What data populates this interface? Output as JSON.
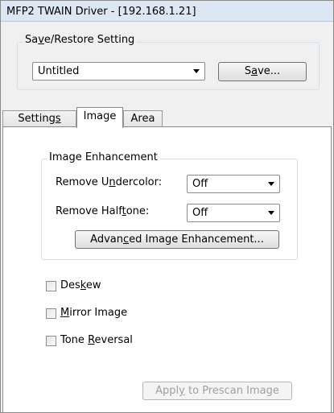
{
  "window": {
    "title": "MFP2 TWAIN Driver - [192.168.1.21]"
  },
  "save_restore": {
    "label_pre": "Sa",
    "label_u": "v",
    "label_post": "e/Restore Setting",
    "selected": "Untitled",
    "save_pre": "S",
    "save_u": "a",
    "save_post": "ve..."
  },
  "tabs": [
    {
      "pre": "Setting",
      "u": "s",
      "post": "",
      "active": false
    },
    {
      "pre": "Image",
      "u": "",
      "post": "",
      "active": true
    },
    {
      "pre": "Area",
      "u": "",
      "post": "",
      "active": false
    }
  ],
  "image_enhancement": {
    "title": "Image Enhancement",
    "undercolor_pre": "Remove U",
    "undercolor_u": "n",
    "undercolor_post": "dercolor:",
    "undercolor_value": "Off",
    "halftone_pre": "Remove Half",
    "halftone_u": "t",
    "halftone_post": "one:",
    "halftone_value": "Off",
    "advanced_pre": "Advan",
    "advanced_u": "c",
    "advanced_post": "ed Image Enhancement..."
  },
  "options": {
    "deskew_pre": "Des",
    "deskew_u": "k",
    "deskew_post": "ew",
    "mirror_pre": "",
    "mirror_u": "M",
    "mirror_post": "irror Image",
    "tone_pre": "Tone ",
    "tone_u": "R",
    "tone_post": "eversal"
  },
  "apply_button": {
    "pre": "Appl",
    "u": "y",
    "post": " to Prescan Image"
  }
}
